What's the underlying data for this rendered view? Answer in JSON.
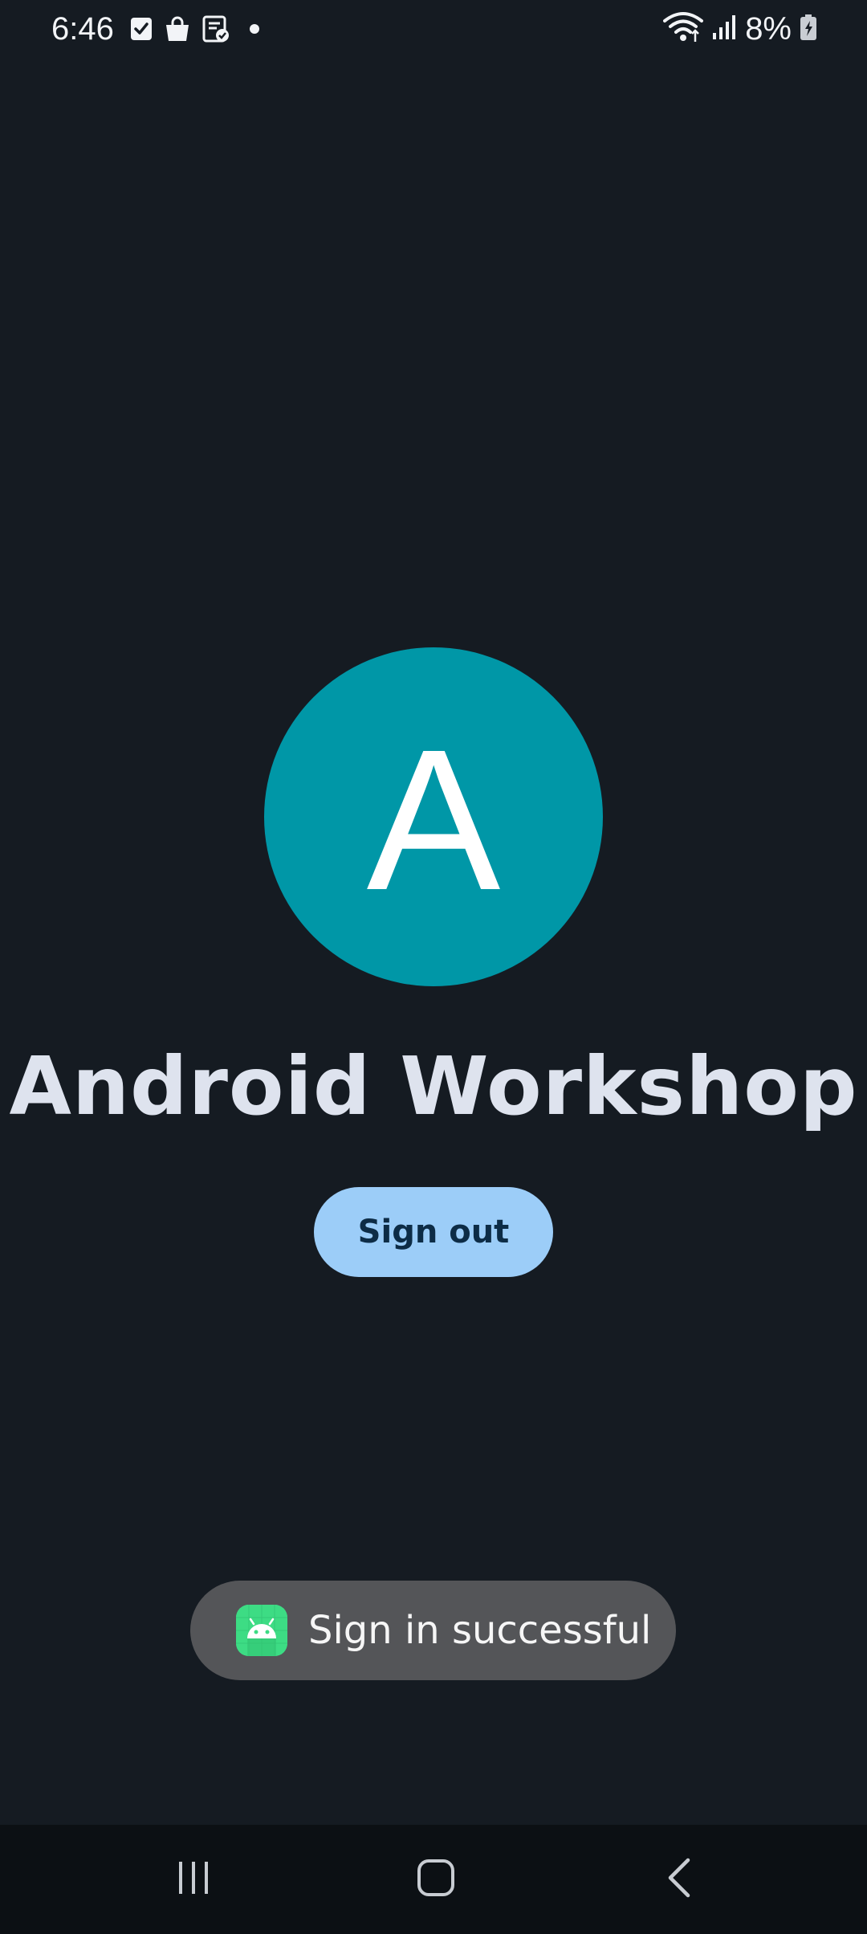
{
  "status_bar": {
    "time": "6:46",
    "battery": "8%",
    "left_icons": [
      "checkbox-icon",
      "shopping-bag-icon",
      "notes-check-icon",
      "dot-icon"
    ],
    "right_icons": [
      "wifi-icon",
      "signal-icon",
      "battery-charging-icon"
    ]
  },
  "profile": {
    "avatar_letter": "A",
    "avatar_color": "#0097a7",
    "name": "Android Workshop"
  },
  "actions": {
    "sign_out_label": "Sign out",
    "button_color": "#9ccdf8"
  },
  "toast": {
    "message": "Sign in successful",
    "icon": "android-app-icon"
  },
  "nav": {
    "recents_icon": "recents-icon",
    "home_icon": "home-icon",
    "back_icon": "back-icon"
  },
  "colors": {
    "background": "#151b22",
    "nav_bar": "#0c1014",
    "toast_bg": "#545558"
  }
}
